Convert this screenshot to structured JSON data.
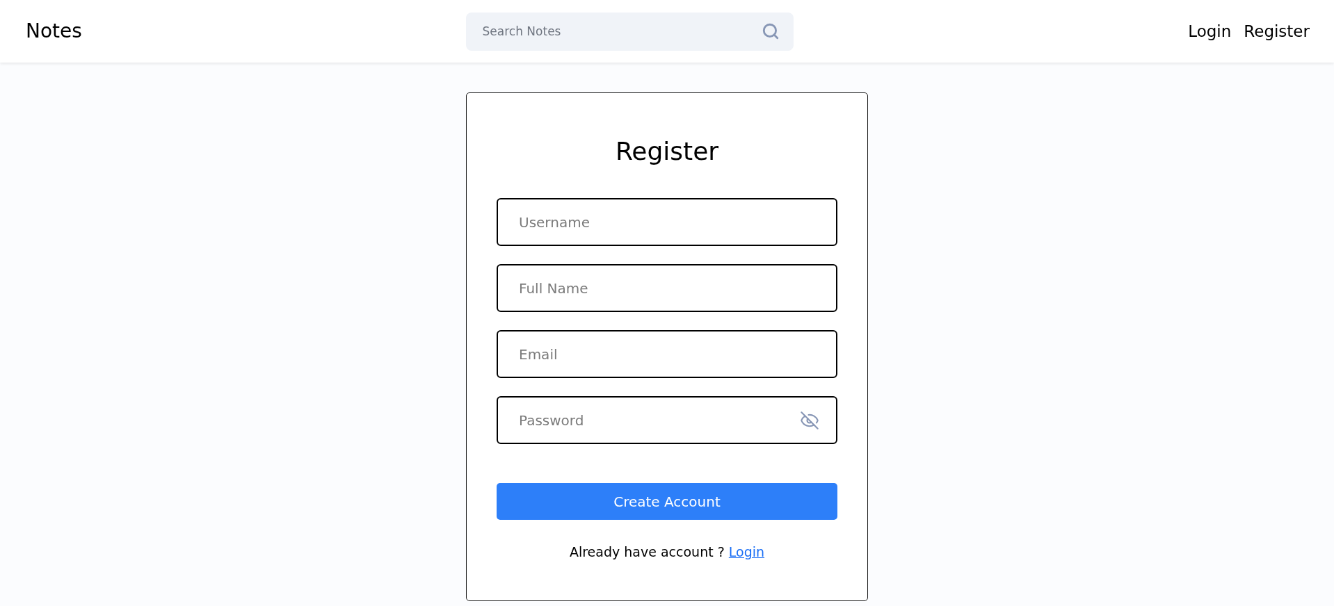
{
  "header": {
    "brand": "Notes",
    "search": {
      "placeholder": "Search Notes"
    },
    "nav": [
      {
        "label": "Login"
      },
      {
        "label": "Register"
      }
    ]
  },
  "form": {
    "title": "Register",
    "fields": [
      {
        "kind": "text",
        "placeholder": "Username"
      },
      {
        "kind": "text",
        "placeholder": "Full Name"
      },
      {
        "kind": "text",
        "placeholder": "Email"
      },
      {
        "kind": "password",
        "placeholder": "Password",
        "visible": false
      }
    ],
    "submit": "Create Account",
    "footer": {
      "text": "Already have account ?",
      "link": "Login"
    }
  }
}
